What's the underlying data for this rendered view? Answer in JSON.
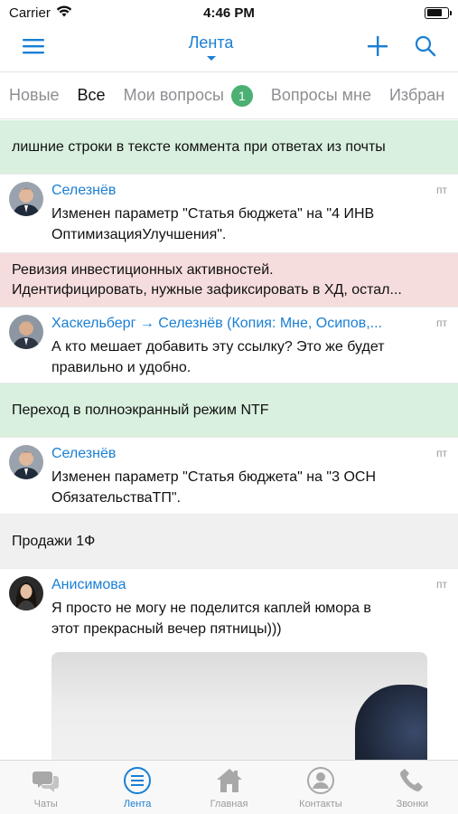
{
  "status_bar": {
    "carrier": "Carrier",
    "time": "4:46 PM",
    "battery_level": 0.75
  },
  "nav": {
    "title": "Лента",
    "menu_icon": "hamburger-icon",
    "add_icon": "plus-icon",
    "search_icon": "search-icon"
  },
  "tabs": [
    {
      "label": "Новые"
    },
    {
      "label": "Все",
      "active": true
    },
    {
      "label": "Мои вопросы",
      "badge": "1"
    },
    {
      "label": "Вопросы мне"
    },
    {
      "label": "Избран"
    }
  ],
  "feed": {
    "banner_1": "лишние строки в тексте коммента при ответах из почты",
    "post_1": {
      "author": "Селезнёв",
      "time": "пт",
      "text_line1": "Изменен параметр \"Статья бюджета\" на \"4 ИНВ",
      "text_line2": "ОптимизацияУлучшения\"."
    },
    "banner_2_line1": "Ревизия инвестиционных активностей.",
    "banner_2_line2": "Идентифицировать, нужные зафиксировать в ХД, остал...",
    "post_2": {
      "author": "Хаскельберг → Селезнёв (Копия: Мне, Осипов,...",
      "time": "пт",
      "text_line1": "А кто мешает добавить эту ссылку? Это же будет",
      "text_line2": "правильно и удобно."
    },
    "banner_3": "Переход в полноэкранный режим NTF",
    "post_3": {
      "author": "Селезнёв",
      "time": "пт",
      "text_line1": "Изменен параметр \"Статья бюджета\" на \"3 ОСН",
      "text_line2": "ОбязательстваТП\"."
    },
    "banner_4": "Продажи 1Ф",
    "post_4": {
      "author": "Анисимова",
      "time": "пт",
      "text_line1": "Я просто не могу не поделится каплей юмора в",
      "text_line2": "этот прекрасный вечер пятницы)))"
    }
  },
  "tab_bar": {
    "chats": "Чаты",
    "feed": "Лента",
    "home": "Главная",
    "contacts": "Контакты",
    "calls": "Звонки"
  },
  "colors": {
    "accent": "#1a7fd4",
    "badge": "#4caf73",
    "banner_green": "#d9f0de",
    "banner_red": "#f6dddd",
    "banner_gray": "#f0f0f0"
  }
}
